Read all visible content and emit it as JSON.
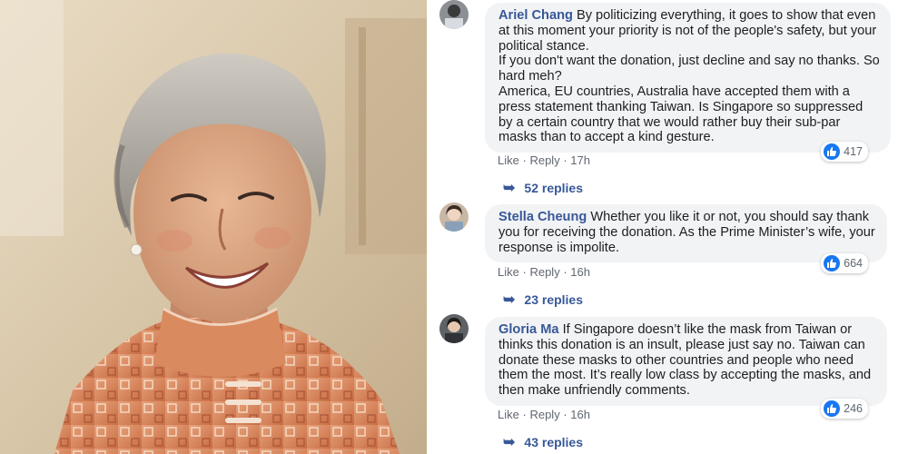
{
  "comments": [
    {
      "author": "Ariel Chang",
      "paragraphs": [
        "By politicizing everything, it goes to show that even at this moment your priority is not of the people's safety, but your political stance.",
        "If you don't want the donation, just decline and say no thanks. So hard meh?",
        "America, EU countries, Australia have accepted them with a press statement thanking Taiwan. Is Singapore so suppressed by a certain country that we would rather buy their sub-par masks than to accept a kind gesture."
      ],
      "like": "Like",
      "reply": "Reply",
      "separator": "·",
      "time": "17h",
      "reaction_count": "417",
      "replies": "52 replies"
    },
    {
      "author": "Stella Cheung",
      "paragraphs": [
        "Whether you like it or not, you should say thank you for receiving the donation. As the Prime Minister’s wife, your response is impolite."
      ],
      "like": "Like",
      "reply": "Reply",
      "separator": "·",
      "time": "16h",
      "reaction_count": "664",
      "replies": "23 replies"
    },
    {
      "author": "Gloria Ma",
      "paragraphs": [
        "If Singapore doesn’t like the mask from Taiwan or thinks this donation is an insult, please just say no. Taiwan can donate these masks to other countries and people who need them the most. It’s really low class by accepting the masks, and then make unfriendly comments."
      ],
      "like": "Like",
      "reply": "Reply",
      "separator": "·",
      "time": "16h",
      "reaction_count": "246",
      "replies": "43 replies"
    }
  ],
  "colors": {
    "author": "#385898",
    "bubble": "#f2f3f5",
    "like_blue": "#1877f2",
    "meta": "#606770"
  },
  "icons": [
    "avatar",
    "like-thumb-icon",
    "reply-arrow-icon"
  ]
}
